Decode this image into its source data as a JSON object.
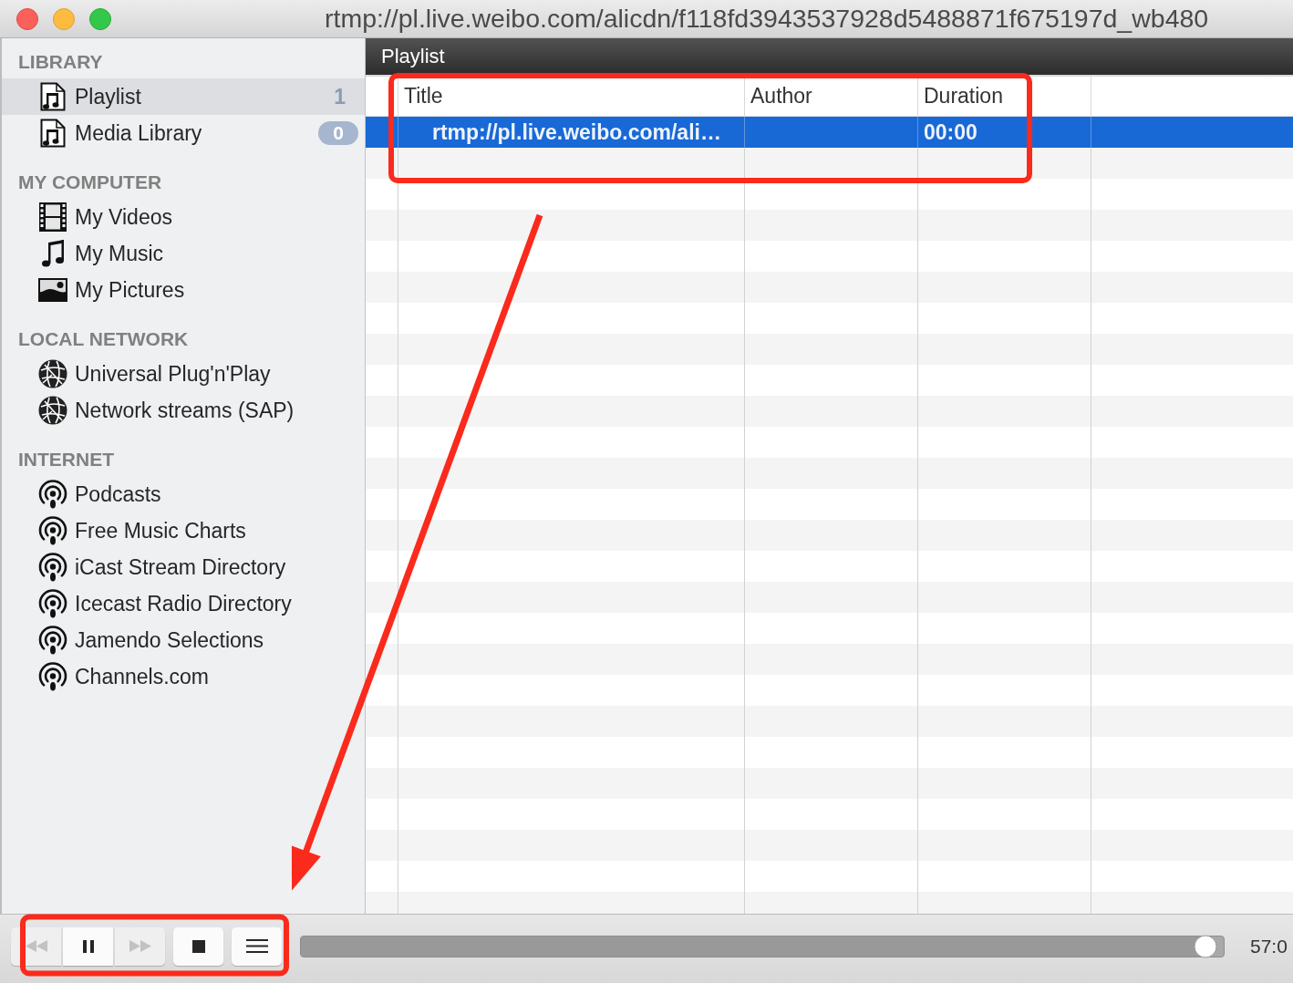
{
  "window": {
    "title": "rtmp://pl.live.weibo.com/alicdn/f118fd3943537928d5488871f675197d_wb480"
  },
  "sidebar": {
    "sections": [
      {
        "title": "LIBRARY",
        "items": [
          {
            "label": "Playlist",
            "kind": "list",
            "selected": true,
            "badge": "1"
          },
          {
            "label": "Media Library",
            "kind": "list",
            "selected": false,
            "badge": "0"
          }
        ]
      },
      {
        "title": "MY COMPUTER",
        "items": [
          {
            "label": "My Videos",
            "kind": "videos",
            "selected": false
          },
          {
            "label": "My Music",
            "kind": "music",
            "selected": false
          },
          {
            "label": "My Pictures",
            "kind": "pictures",
            "selected": false
          }
        ]
      },
      {
        "title": "LOCAL NETWORK",
        "items": [
          {
            "label": "Universal Plug'n'Play",
            "kind": "network",
            "selected": false
          },
          {
            "label": "Network streams (SAP)",
            "kind": "network",
            "selected": false
          }
        ]
      },
      {
        "title": "INTERNET",
        "items": [
          {
            "label": "Podcasts",
            "kind": "podcast",
            "selected": false
          },
          {
            "label": "Free Music Charts",
            "kind": "podcast",
            "selected": false
          },
          {
            "label": "iCast Stream Directory",
            "kind": "podcast",
            "selected": false
          },
          {
            "label": "Icecast Radio Directory",
            "kind": "podcast",
            "selected": false
          },
          {
            "label": "Jamendo Selections",
            "kind": "podcast",
            "selected": false
          },
          {
            "label": "Channels.com",
            "kind": "podcast",
            "selected": false
          }
        ]
      }
    ]
  },
  "playlist": {
    "title": "Playlist",
    "table": {
      "columns": [
        {
          "label": "Title"
        },
        {
          "label": "Author"
        },
        {
          "label": "Duration"
        }
      ],
      "rows": [
        {
          "title": "rtmp://pl.live.weibo.com/ali…",
          "duration": "00:00",
          "selected": true
        }
      ]
    }
  },
  "controls": {
    "buttons": [
      {
        "kind": "previous",
        "disabled": true
      },
      {
        "kind": "pause",
        "disabled": false
      },
      {
        "kind": "next",
        "disabled": true
      },
      {
        "kind": "stop",
        "disabled": false
      },
      {
        "kind": "playlist",
        "disabled": false
      }
    ],
    "position": {
      "level": 0.98
    },
    "time": "57:0"
  },
  "annotations": [
    {
      "kind": "frame"
    },
    {
      "kind": "frame"
    },
    {
      "kind": "arrow"
    }
  ]
}
